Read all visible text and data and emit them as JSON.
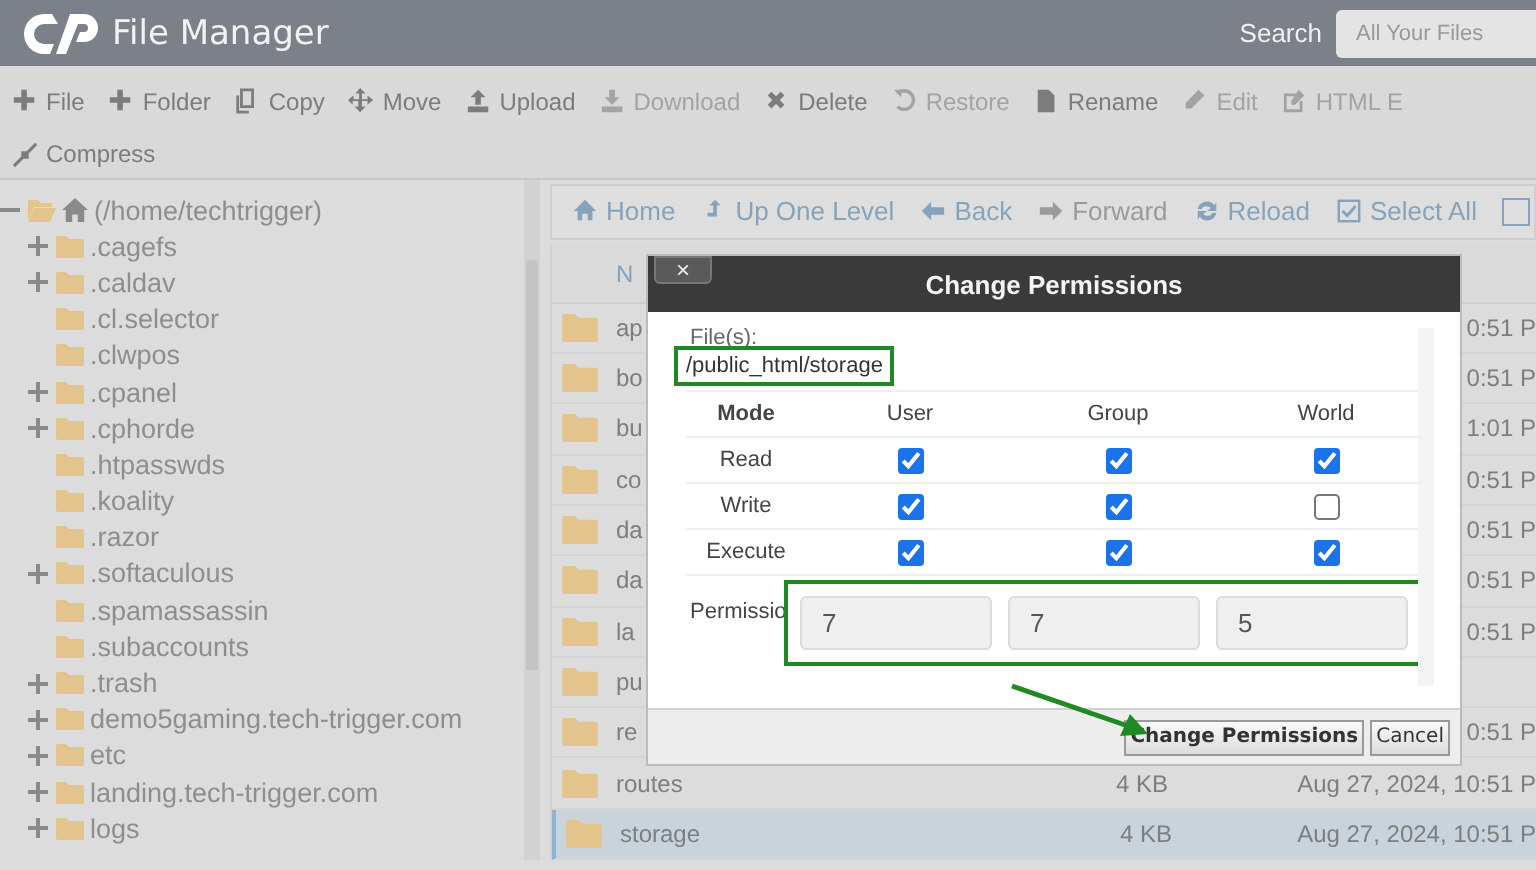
{
  "header": {
    "title": "File Manager",
    "search_label": "Search",
    "search_placeholder": "All Your Files"
  },
  "toolbar": [
    [
      {
        "label": "File",
        "disabled": false
      },
      {
        "label": "Folder",
        "disabled": false
      },
      {
        "label": "Copy",
        "disabled": false
      },
      {
        "label": "Move",
        "disabled": false
      },
      {
        "label": "Upload",
        "disabled": false
      },
      {
        "label": "Download",
        "disabled": true
      },
      {
        "label": "Delete",
        "disabled": false
      },
      {
        "label": "Restore",
        "disabled": true
      },
      {
        "label": "Rename",
        "disabled": false
      },
      {
        "label": "Edit",
        "disabled": true
      },
      {
        "label": "HTML E",
        "disabled": true
      }
    ],
    [
      {
        "label": "Compress",
        "disabled": false
      }
    ]
  ],
  "tree": {
    "label": "(/home/techtrigger)",
    "expanded": true,
    "children": [
      {
        "label": ".cagefs",
        "expandable": true
      },
      {
        "label": ".caldav",
        "expandable": true
      },
      {
        "label": ".cl.selector",
        "expandable": false
      },
      {
        "label": ".clwpos",
        "expandable": false
      },
      {
        "label": ".cpanel",
        "expandable": true
      },
      {
        "label": ".cphorde",
        "expandable": true
      },
      {
        "label": ".htpasswds",
        "expandable": false
      },
      {
        "label": ".koality",
        "expandable": false
      },
      {
        "label": ".razor",
        "expandable": false
      },
      {
        "label": ".softaculous",
        "expandable": true
      },
      {
        "label": ".spamassassin",
        "expandable": false
      },
      {
        "label": ".subaccounts",
        "expandable": false
      },
      {
        "label": ".trash",
        "expandable": true
      },
      {
        "label": "demo5gaming.tech-trigger.com",
        "expandable": true
      },
      {
        "label": "etc",
        "expandable": true
      },
      {
        "label": "landing.tech-trigger.com",
        "expandable": true
      },
      {
        "label": "logs",
        "expandable": true
      }
    ]
  },
  "nav": [
    {
      "label": "Home",
      "disabled": false
    },
    {
      "label": "Up One Level",
      "disabled": false
    },
    {
      "label": "Back",
      "disabled": false
    },
    {
      "label": "Forward",
      "disabled": true
    },
    {
      "label": "Reload",
      "disabled": false
    },
    {
      "label": "Select All",
      "disabled": false
    }
  ],
  "table": {
    "columns": [
      "N"
    ],
    "rows": [
      {
        "name": "ap",
        "date": "0:51 P",
        "selected": false
      },
      {
        "name": "bo",
        "date": "0:51 P",
        "selected": false
      },
      {
        "name": "bu",
        "date": "1:01 P",
        "selected": false
      },
      {
        "name": "co",
        "date": "0:51 P",
        "selected": false
      },
      {
        "name": "da",
        "date": "0:51 P",
        "selected": false
      },
      {
        "name": "da",
        "date": "0:51 P",
        "selected": false
      },
      {
        "name": "la",
        "date": "0:51 P",
        "selected": false
      },
      {
        "name": "pu",
        "selected": false
      },
      {
        "name": "re",
        "date": "0:51 P",
        "selected": false
      },
      {
        "name": "routes",
        "size": "4 KB",
        "date": "Aug 27, 2024, 10:51 P",
        "selected": false
      },
      {
        "name": "storage",
        "size": "4 KB",
        "date": "Aug 27, 2024, 10:51 P",
        "selected": true
      }
    ]
  },
  "dialog": {
    "title": "Change Permissions",
    "close": "×",
    "files_label": "File(s):",
    "path": "/public_html/storage",
    "path_highlighted": true,
    "columns": [
      "Mode",
      "User",
      "Group",
      "World"
    ],
    "rows": [
      {
        "label": "Read",
        "checks": [
          {
            "checked": true
          },
          {
            "checked": true
          },
          {
            "checked": true
          }
        ]
      },
      {
        "label": "Write",
        "checks": [
          {
            "checked": true
          },
          {
            "checked": true
          },
          {
            "checked": false
          }
        ]
      },
      {
        "label": "Execute",
        "checks": [
          {
            "checked": true
          },
          {
            "checked": true
          },
          {
            "checked": true
          }
        ]
      }
    ],
    "permission_label": "Permissio",
    "permission_values": [
      "7",
      "7",
      "5"
    ],
    "permissions_highlighted": true,
    "buttons": [
      {
        "label": "Change Permissions",
        "kind": "default"
      },
      {
        "label": "Cancel",
        "kind": "plain"
      }
    ]
  }
}
